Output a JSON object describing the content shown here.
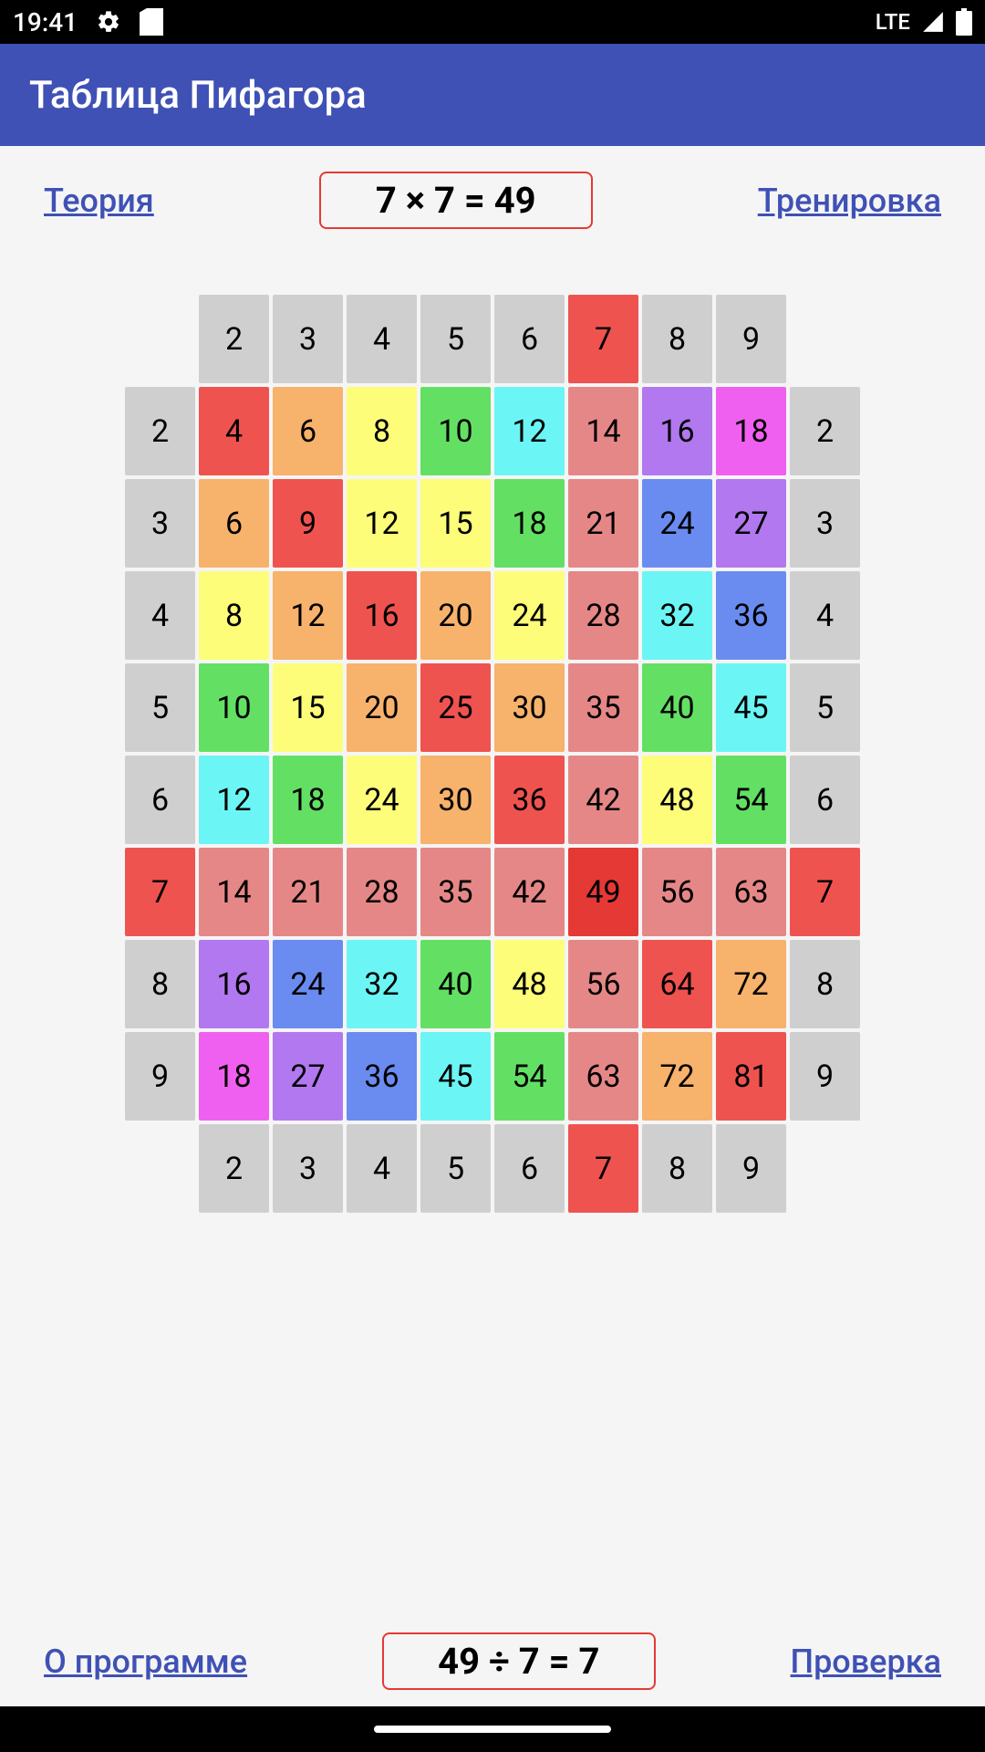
{
  "status_bar": {
    "time": "19:41",
    "network": "LTE"
  },
  "app": {
    "title": "Таблица Пифагора"
  },
  "top": {
    "theory_link": "Теория",
    "training_link": "Тренировка",
    "formula": "7 × 7 = 49"
  },
  "bottom": {
    "about_link": "О программе",
    "check_link": "Проверка",
    "formula": "49 ÷ 7 = 7"
  },
  "colors": {
    "header": "#cfcfcf",
    "hl_red": "#ef5350",
    "row_pink": "#e68787",
    "orange": "#f7b26c",
    "yellow": "#fdfd7a",
    "green": "#63e063",
    "cyan": "#6cf5f5",
    "blue": "#6a8cf0",
    "purple": "#b278ef",
    "magenta": "#f060f0",
    "sel_red": "#e53935"
  },
  "table": {
    "top_header": [
      "2",
      "3",
      "4",
      "5",
      "6",
      "7",
      "8",
      "9"
    ],
    "bottom_header": [
      "2",
      "3",
      "4",
      "5",
      "6",
      "7",
      "8",
      "9"
    ],
    "highlight_header_index": 5,
    "rows": [
      {
        "left": "2",
        "right": "2",
        "cells": [
          {
            "v": "4",
            "c": "hl_red"
          },
          {
            "v": "6",
            "c": "orange"
          },
          {
            "v": "8",
            "c": "yellow"
          },
          {
            "v": "10",
            "c": "green"
          },
          {
            "v": "12",
            "c": "cyan"
          },
          {
            "v": "14",
            "c": "row_pink"
          },
          {
            "v": "16",
            "c": "purple"
          },
          {
            "v": "18",
            "c": "magenta"
          }
        ]
      },
      {
        "left": "3",
        "right": "3",
        "cells": [
          {
            "v": "6",
            "c": "orange"
          },
          {
            "v": "9",
            "c": "hl_red"
          },
          {
            "v": "12",
            "c": "yellow"
          },
          {
            "v": "15",
            "c": "yellow"
          },
          {
            "v": "18",
            "c": "green"
          },
          {
            "v": "21",
            "c": "row_pink"
          },
          {
            "v": "24",
            "c": "blue"
          },
          {
            "v": "27",
            "c": "purple"
          }
        ]
      },
      {
        "left": "4",
        "right": "4",
        "cells": [
          {
            "v": "8",
            "c": "yellow"
          },
          {
            "v": "12",
            "c": "orange"
          },
          {
            "v": "16",
            "c": "hl_red"
          },
          {
            "v": "20",
            "c": "orange"
          },
          {
            "v": "24",
            "c": "yellow"
          },
          {
            "v": "28",
            "c": "row_pink"
          },
          {
            "v": "32",
            "c": "cyan"
          },
          {
            "v": "36",
            "c": "blue"
          }
        ]
      },
      {
        "left": "5",
        "right": "5",
        "cells": [
          {
            "v": "10",
            "c": "green"
          },
          {
            "v": "15",
            "c": "yellow"
          },
          {
            "v": "20",
            "c": "orange"
          },
          {
            "v": "25",
            "c": "hl_red"
          },
          {
            "v": "30",
            "c": "orange"
          },
          {
            "v": "35",
            "c": "row_pink"
          },
          {
            "v": "40",
            "c": "green"
          },
          {
            "v": "45",
            "c": "cyan"
          }
        ]
      },
      {
        "left": "6",
        "right": "6",
        "cells": [
          {
            "v": "12",
            "c": "cyan"
          },
          {
            "v": "18",
            "c": "green"
          },
          {
            "v": "24",
            "c": "yellow"
          },
          {
            "v": "30",
            "c": "orange"
          },
          {
            "v": "36",
            "c": "hl_red"
          },
          {
            "v": "42",
            "c": "row_pink"
          },
          {
            "v": "48",
            "c": "yellow"
          },
          {
            "v": "54",
            "c": "green"
          }
        ]
      },
      {
        "left": "7",
        "right": "7",
        "hl": true,
        "cells": [
          {
            "v": "14",
            "c": "row_pink"
          },
          {
            "v": "21",
            "c": "row_pink"
          },
          {
            "v": "28",
            "c": "row_pink"
          },
          {
            "v": "35",
            "c": "row_pink"
          },
          {
            "v": "42",
            "c": "row_pink"
          },
          {
            "v": "49",
            "c": "sel_red"
          },
          {
            "v": "56",
            "c": "row_pink"
          },
          {
            "v": "63",
            "c": "row_pink"
          }
        ]
      },
      {
        "left": "8",
        "right": "8",
        "cells": [
          {
            "v": "16",
            "c": "purple"
          },
          {
            "v": "24",
            "c": "blue"
          },
          {
            "v": "32",
            "c": "cyan"
          },
          {
            "v": "40",
            "c": "green"
          },
          {
            "v": "48",
            "c": "yellow"
          },
          {
            "v": "56",
            "c": "row_pink"
          },
          {
            "v": "64",
            "c": "hl_red"
          },
          {
            "v": "72",
            "c": "orange"
          }
        ]
      },
      {
        "left": "9",
        "right": "9",
        "cells": [
          {
            "v": "18",
            "c": "magenta"
          },
          {
            "v": "27",
            "c": "purple"
          },
          {
            "v": "36",
            "c": "blue"
          },
          {
            "v": "45",
            "c": "cyan"
          },
          {
            "v": "54",
            "c": "green"
          },
          {
            "v": "63",
            "c": "row_pink"
          },
          {
            "v": "72",
            "c": "orange"
          },
          {
            "v": "81",
            "c": "hl_red"
          }
        ]
      }
    ]
  }
}
